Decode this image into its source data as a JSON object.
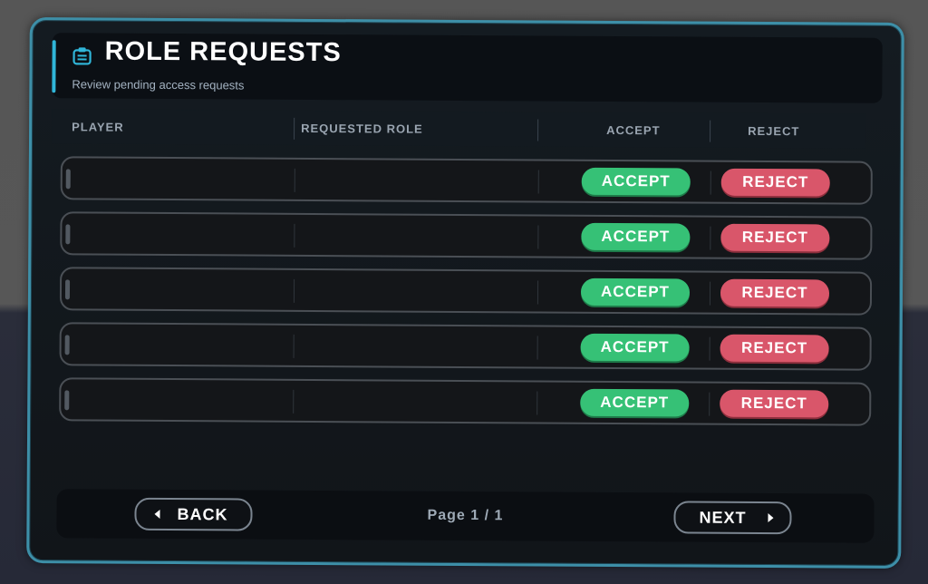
{
  "header": {
    "title": "ROLE REQUESTS",
    "subtitle": "Review pending access requests",
    "icon": "clipboard-icon",
    "accent_color": "#30b6d9"
  },
  "columns": {
    "player": "PLAYER",
    "requested_role": "REQUESTED ROLE",
    "accept": "ACCEPT",
    "reject": "REJECT"
  },
  "rows": [
    {
      "player": "",
      "role": "",
      "accept_label": "ACCEPT",
      "reject_label": "REJECT"
    },
    {
      "player": "",
      "role": "",
      "accept_label": "ACCEPT",
      "reject_label": "REJECT"
    },
    {
      "player": "",
      "role": "",
      "accept_label": "ACCEPT",
      "reject_label": "REJECT"
    },
    {
      "player": "",
      "role": "",
      "accept_label": "ACCEPT",
      "reject_label": "REJECT"
    },
    {
      "player": "",
      "role": "",
      "accept_label": "ACCEPT",
      "reject_label": "REJECT"
    }
  ],
  "footer": {
    "back_label": "BACK",
    "next_label": "NEXT",
    "page_indicator": "Page 1 / 1"
  },
  "colors": {
    "accept": "#36c176",
    "reject": "#d9566a",
    "panel_border": "#3d8fa8"
  }
}
